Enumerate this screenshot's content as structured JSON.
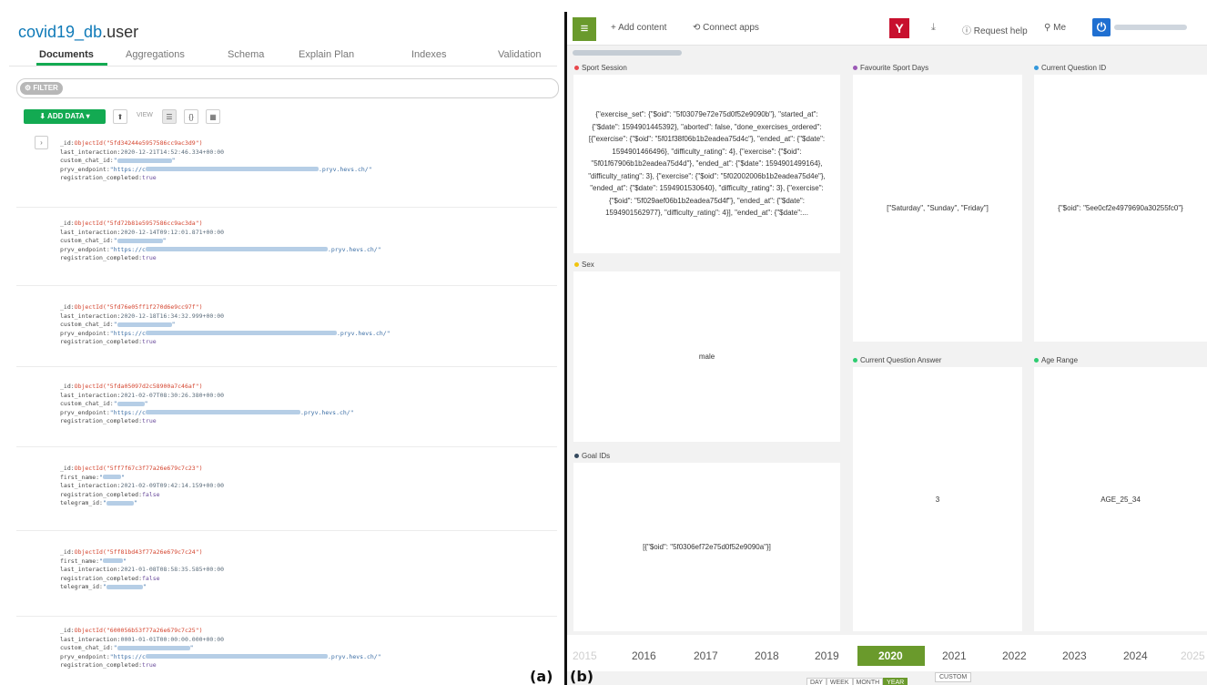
{
  "left": {
    "db": "covid19_db",
    "collection": ".user",
    "tabs": [
      "Documents",
      "Aggregations",
      "Schema",
      "Explain Plan",
      "Indexes",
      "Validation"
    ],
    "filter_label": "FILTER",
    "add_data_label": "ADD DATA",
    "view_label": "VIEW",
    "documents": [
      {
        "id": "ObjectId(\"5fd34244e5957586cc9ac3d9\")",
        "last_interaction": "2020-12-21T14:52:46.334+00:00",
        "custom_chat_id": "\"",
        "pryv_suffix": ".pryv.hevs.ch/\"",
        "pryv_prefix": "\"https://c",
        "registration_completed": "true"
      },
      {
        "id": "ObjectId(\"5fd72b81e5957586cc9ac3da\")",
        "last_interaction": "2020-12-14T09:12:01.871+00:00",
        "custom_chat_id": "\"",
        "pryv_suffix": ".pryv.hevs.ch/\"",
        "pryv_prefix": "\"https://c",
        "registration_completed": "true"
      },
      {
        "id": "ObjectId(\"5fd76e05ff1f270d6e9cc97f\")",
        "last_interaction": "2020-12-18T16:34:32.999+00:00",
        "custom_chat_id": "\"",
        "pryv_suffix": ".pryv.hevs.ch/\"",
        "pryv_prefix": "\"https://c",
        "registration_completed": "true"
      },
      {
        "id": "ObjectId(\"5fda05097d2c58900a7c46af\")",
        "last_interaction": "2021-02-07T08:30:26.380+00:00",
        "custom_chat_id": "\"",
        "pryv_suffix": ".pryv.hevs.ch/\"",
        "pryv_prefix": "\"https://c",
        "registration_completed": "true"
      }
    ],
    "documents_b": [
      {
        "id": "ObjectId(\"5ff7f67c3f77a26e679c7c23\")",
        "first_name": "\"",
        "last_interaction": "2021-02-09T09:42:14.159+00:00",
        "registration_completed": "false",
        "telegram_id": "\""
      },
      {
        "id": "ObjectId(\"5ff81bd43f77a26e679c7c24\")",
        "first_name": "\"",
        "last_interaction": "2021-01-08T08:58:35.585+00:00",
        "registration_completed": "false",
        "telegram_id": "\""
      }
    ],
    "document_last": {
      "id": "ObjectId(\"600056b53f77a26e679c7c25\")",
      "last_interaction": "0001-01-01T00:00:00.000+00:00",
      "custom_chat_id": "\"",
      "pryv_prefix": "\"https://c",
      "pryv_suffix": ".pryv.hevs.ch/\"",
      "registration_completed": "true"
    },
    "keys": {
      "_id": "_id:",
      "last_interaction": "last_interaction:",
      "custom_chat_id": "custom_chat_id:",
      "pryv_endpoint": "pryv_endpoint:",
      "registration_completed": "registration_completed:",
      "first_name": "first_name:",
      "telegram_id": "telegram_id:"
    }
  },
  "captions": {
    "a": "(a)",
    "b": "(b)"
  },
  "right": {
    "toolbar": {
      "add_content": "+ Add content",
      "connect_apps": "Connect apps",
      "request_help": "Request help",
      "me": "Me",
      "y_logo": "Y"
    },
    "cards": {
      "sport_session": {
        "label": "Sport Session",
        "dot_color": "#e8474c",
        "value": "{\"exercise_set\": {\"$oid\": \"5f03079e72e75d0f52e9090b\"}, \"started_at\": {\"$date\": 1594901445392}, \"aborted\": false, \"done_exercises_ordered\": [{\"exercise\": {\"$oid\": \"5f01f38f06b1b2eadea75d4c\"}, \"ended_at\": {\"$date\": 1594901466496}, \"difficulty_rating\": 4}, {\"exercise\": {\"$oid\": \"5f01f67906b1b2eadea75d4d\"}, \"ended_at\": {\"$date\": 1594901499164}, \"difficulty_rating\": 3}, {\"exercise\": {\"$oid\": \"5f02002006b1b2eadea75d4e\"}, \"ended_at\": {\"$date\": 1594901530640}, \"difficulty_rating\": 3}, {\"exercise\": {\"$oid\": \"5f029aef06b1b2eadea75d4f\"}, \"ended_at\": {\"$date\": 1594901562977}, \"difficulty_rating\": 4}], \"ended_at\": {\"$date\":..."
      },
      "favourite_sport_days": {
        "label": "Favourite Sport Days",
        "dot_color": "#9b59b6",
        "value": "[\"Saturday\", \"Sunday\", \"Friday\"]"
      },
      "current_question_id": {
        "label": "Current Question ID",
        "dot_color": "#3498db",
        "value": "{\"$oid\": \"5ee0cf2e4979690a30255fc0\"}"
      },
      "sex": {
        "label": "Sex",
        "dot_color": "#f1c40f",
        "value": "male"
      },
      "current_question_answer": {
        "label": "Current Question Answer",
        "dot_color": "#2ecc71",
        "value": "3"
      },
      "age_range": {
        "label": "Age Range",
        "dot_color": "#2ecc71",
        "value": "AGE_25_34"
      },
      "goal_ids": {
        "label": "Goal IDs",
        "dot_color": "#34495e",
        "value": "[{\"$oid\": \"5f0306ef72e75d0f52e9090a\"}]"
      }
    },
    "years": [
      "2015",
      "2016",
      "2017",
      "2018",
      "2019",
      "2020",
      "2021",
      "2022",
      "2023",
      "2024",
      "2025"
    ],
    "active_year": "2020",
    "granularity": [
      "DAY",
      "WEEK",
      "MONTH",
      "YEAR"
    ],
    "active_granularity": "YEAR",
    "custom_label": "CUSTOM"
  }
}
